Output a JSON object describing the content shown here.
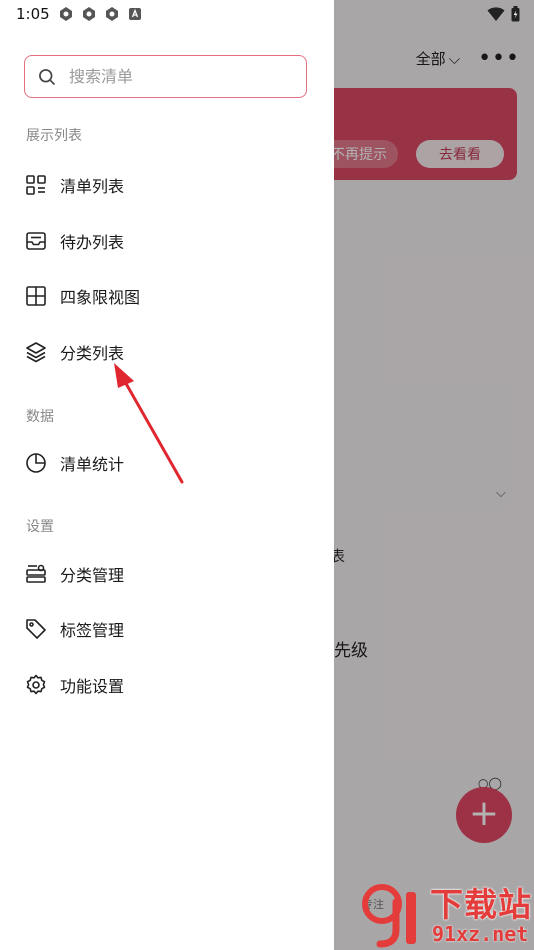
{
  "status_bar": {
    "time": "1:05"
  },
  "background": {
    "filter_label": "全部",
    "banner": {
      "dismiss": "不再提示",
      "view": "去看看"
    },
    "snippet_1": "表",
    "snippet_2": "先级",
    "bottom_label": "专注"
  },
  "drawer": {
    "search": {
      "placeholder": "搜索清单"
    },
    "sections": [
      {
        "title": "展示列表",
        "items": [
          "清单列表",
          "待办列表",
          "四象限视图",
          "分类列表"
        ]
      },
      {
        "title": "数据",
        "items": [
          "清单统计"
        ]
      },
      {
        "title": "设置",
        "items": [
          "分类管理",
          "标签管理",
          "功能设置"
        ]
      }
    ]
  },
  "watermark": {
    "title": "下载站",
    "url": "91xz.net"
  },
  "colors": {
    "accent": "#d94a64",
    "search_border": "#e2707f",
    "arrow": "#e0262e"
  }
}
